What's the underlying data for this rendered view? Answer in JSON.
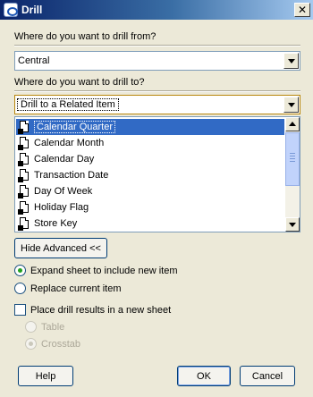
{
  "window": {
    "title": "Drill",
    "close_glyph": "✕"
  },
  "drill_from": {
    "label": "Where do you want to drill from?",
    "value": "Central"
  },
  "drill_to": {
    "label": "Where do you want to drill to?",
    "value": "Drill to a Related Item"
  },
  "items": [
    {
      "label": "Calendar Quarter",
      "selected": true
    },
    {
      "label": "Calendar Month"
    },
    {
      "label": "Calendar Day"
    },
    {
      "label": "Transaction Date"
    },
    {
      "label": "Day Of Week"
    },
    {
      "label": "Holiday Flag"
    },
    {
      "label": "Store Key"
    }
  ],
  "hide_advanced_button": "Hide Advanced <<",
  "options": {
    "expand_sheet": "Expand sheet to include new item",
    "replace_item": "Replace current item",
    "new_sheet": "Place drill results in a new sheet",
    "table": "Table",
    "crosstab": "Crosstab"
  },
  "buttons": {
    "help": "Help",
    "ok": "OK",
    "cancel": "Cancel"
  },
  "icons": {
    "item_icon": "drill-item-icon",
    "app_icon": "discoverer-icon"
  },
  "colors": {
    "selection": "#316ac5",
    "titlebar": "#0a246a",
    "dialog_bg": "#ece9d8"
  }
}
